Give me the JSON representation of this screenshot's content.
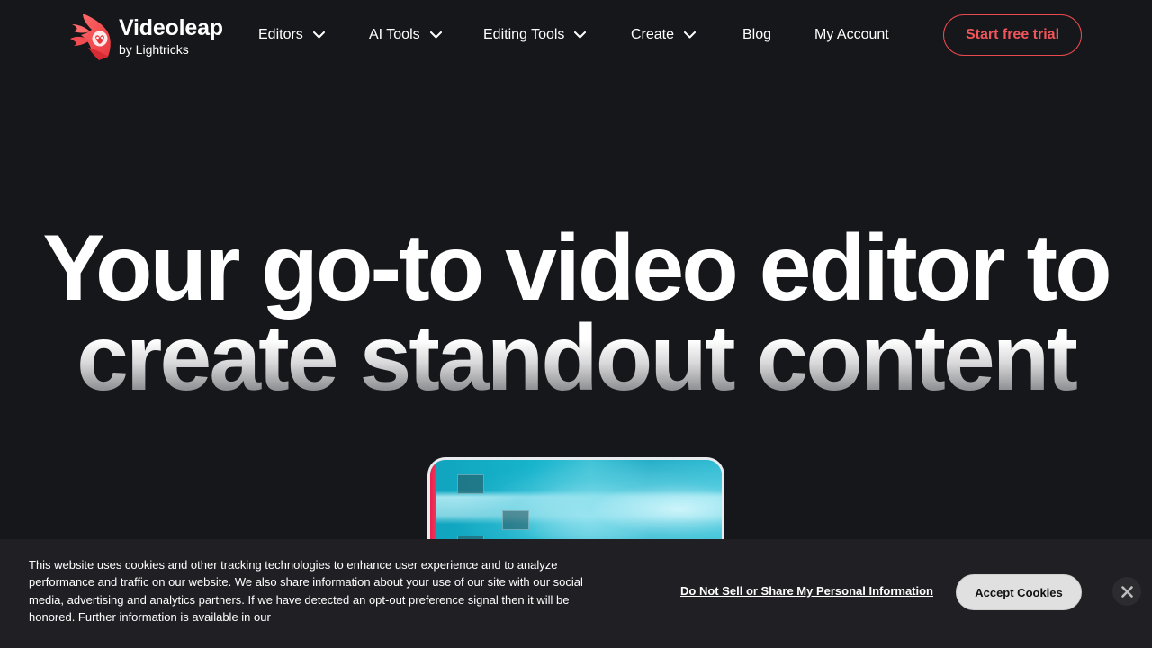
{
  "header": {
    "logo": {
      "name": "Videoleap",
      "byline": "by Lightricks",
      "icon": "videoleap-bird-logo-icon"
    },
    "nav": [
      {
        "label": "Editors",
        "has_dropdown": true,
        "icon": "chevron-down-icon"
      },
      {
        "label": "AI Tools",
        "has_dropdown": true,
        "icon": "chevron-down-icon"
      },
      {
        "label": "Editing Tools",
        "has_dropdown": true,
        "icon": "chevron-down-icon"
      },
      {
        "label": "Create",
        "has_dropdown": true,
        "icon": "chevron-down-icon"
      },
      {
        "label": "Blog",
        "has_dropdown": false
      },
      {
        "label": "My Account",
        "has_dropdown": false
      }
    ],
    "cta_label": "Start free trial"
  },
  "hero": {
    "title_line1": "Your go-to video editor to",
    "title_line2": "create standout content"
  },
  "cookie_banner": {
    "text": "This website uses cookies and other tracking technologies to enhance user experience and to analyze performance and traffic on our website. We also share information about your use of our site with our social media, advertising and analytics partners. If we have detected an opt-out preference signal then it will be honored. Further information is available in our",
    "do_not_sell_label": "Do Not Sell or Share My Personal Information",
    "accept_label": "Accept Cookies",
    "close_icon": "close-icon"
  },
  "colors": {
    "background": "#16171a",
    "accent": "#e94a4f",
    "banner_background": "#202024",
    "accept_button": "#e0e0e0"
  }
}
